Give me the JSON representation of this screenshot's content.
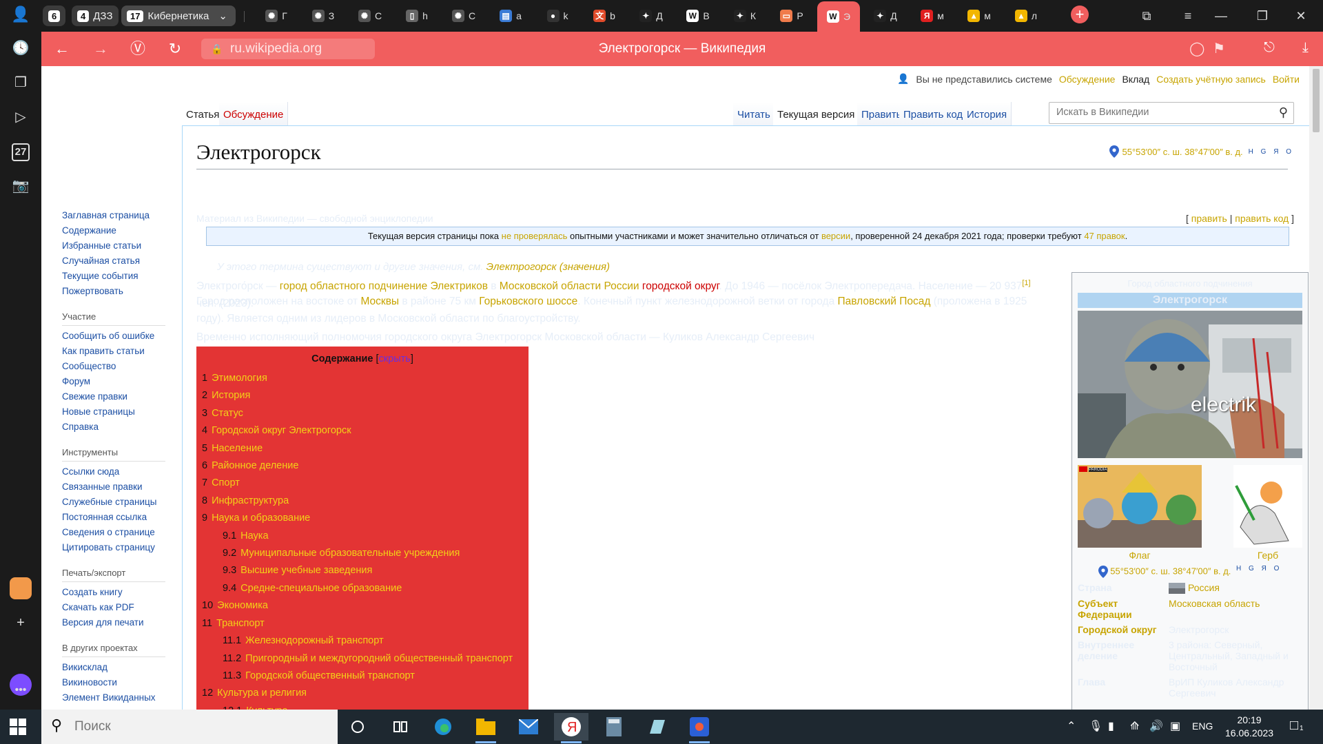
{
  "tabstrip": {
    "groups": [
      {
        "count": "6",
        "label": ""
      },
      {
        "count": "4",
        "label": "ДЗЗ"
      },
      {
        "count": "17",
        "label": "Кибернетика"
      }
    ],
    "mini_tabs": [
      {
        "letter": "Г",
        "icon": "chatgpt-icon"
      },
      {
        "letter": "З",
        "icon": "chatgpt-icon"
      },
      {
        "letter": "С",
        "icon": "chatgpt-icon"
      },
      {
        "letter": "h",
        "icon": "document-icon"
      },
      {
        "letter": "С",
        "icon": "chatgpt-icon"
      },
      {
        "letter": "a",
        "icon": "google-doc-icon"
      },
      {
        "letter": "k",
        "icon": "github-icon"
      },
      {
        "letter": "b",
        "icon": "translate-icon"
      },
      {
        "letter": "Д",
        "icon": "sparkle-icon"
      },
      {
        "letter": "В",
        "icon": "wikipedia-icon"
      },
      {
        "letter": "К",
        "icon": "sparkle-icon"
      },
      {
        "letter": "Р",
        "icon": "slides-icon"
      },
      {
        "letter": "Э",
        "icon": "wikipedia-icon"
      },
      {
        "letter": "Д",
        "icon": "sparkle-icon"
      },
      {
        "letter": "м",
        "icon": "yandex-icon"
      },
      {
        "letter": "м",
        "icon": "yandex-maps-icon"
      },
      {
        "letter": "л",
        "icon": "yandex-maps-icon"
      }
    ]
  },
  "sidepanel": {
    "calendar_day": "27"
  },
  "addressbar": {
    "url": "ru.wikipedia.org",
    "title": "Электрогорск — Википедия"
  },
  "personal": {
    "anon": "Вы не представились системе",
    "talk": "Обсуждение",
    "contrib": "Вклад",
    "create": "Создать учётную запись",
    "login": "Войти"
  },
  "nav": {
    "main": [
      "Заглавная страница",
      "Содержание",
      "Избранные статьи",
      "Случайная статья",
      "Текущие события",
      "Пожертвовать"
    ],
    "participation_title": "Участие",
    "participation": [
      "Сообщить об ошибке",
      "Как править статьи",
      "Сообщество",
      "Форум",
      "Свежие правки",
      "Новые страницы",
      "Справка"
    ],
    "tools_title": "Инструменты",
    "tools": [
      "Ссылки сюда",
      "Связанные правки",
      "Служебные страницы",
      "Постоянная ссылка",
      "Сведения о странице",
      "Цитировать страницу"
    ],
    "print_title": "Печать/экспорт",
    "print": [
      "Создать книгу",
      "Скачать как PDF",
      "Версия для печати"
    ],
    "projects_title": "В других проектах",
    "projects": [
      "Викисклад",
      "Викиновости",
      "Элемент Викиданных"
    ]
  },
  "tabs": {
    "article": "Статья",
    "talk": "Обсуждение",
    "read": "Читать",
    "current": "Текущая версия",
    "edit": "Править",
    "edit_code": "Править код",
    "history": "История"
  },
  "search": {
    "placeholder": "Искать в Википедии"
  },
  "article": {
    "title": "Электрогорск",
    "coords": "55°53′00″ с. ш. 38°47′00″ в. д.",
    "coord_letters": "H G Я O",
    "site_sub": "Материал из Википедии — свободной энциклопедии",
    "edit": "править",
    "edit_code": "править код",
    "flag": {
      "t1": "Текущая версия страницы пока ",
      "l1": "не проверялась",
      "t2": " опытными участниками и может значительно отличаться от ",
      "l2": "версии",
      "t3": ", проверенной 24 декабря 2021 года; проверки требуют ",
      "l3": "47 правок",
      "t4": "."
    },
    "hatnote": {
      "text": "У этого термина существуют и другие значения, см. ",
      "link": "Электрогорск (значения)"
    },
    "p1": {
      "a": "Электрого́рск — ",
      "l1": "город областного подчинение Электриков",
      "b": " в ",
      "l2": "Московской области России",
      "c": " ",
      "l3": "городской округ",
      "d": ". До 1946 — посёлок Электропередача. Население — 20 937",
      "ref": "[1]",
      "e": " чел. (2023)."
    },
    "p2": {
      "a": "Город расположен на востоке от ",
      "l1": "Москвы",
      "b": " в районе 75 км ",
      "l2": "Горьковского шоссе",
      "c": ". Конечный пункт железнодорожной ветки от города ",
      "l3": "Павловский Посад",
      "d": " (проложена в 1925 году). Является одним из лидеров в Московской области по благоустройству."
    },
    "p3": "Временно исполняющий полномочия городского округа Электрогорск Московской области — Куликов Александр Сергеевич"
  },
  "toc": {
    "title": "Содержание",
    "hide": "скрыть",
    "items": [
      {
        "n": "1",
        "t": "Этимология",
        "lvl": 1
      },
      {
        "n": "2",
        "t": "История",
        "lvl": 1
      },
      {
        "n": "3",
        "t": "Статус",
        "lvl": 1
      },
      {
        "n": "4",
        "t": "Городской округ Электрогорск",
        "lvl": 1
      },
      {
        "n": "5",
        "t": "Население",
        "lvl": 1
      },
      {
        "n": "6",
        "t": "Районное деление",
        "lvl": 1
      },
      {
        "n": "7",
        "t": "Спорт",
        "lvl": 1
      },
      {
        "n": "8",
        "t": "Инфраструктура",
        "lvl": 1
      },
      {
        "n": "9",
        "t": "Наука и образование",
        "lvl": 1
      },
      {
        "n": "9.1",
        "t": "Наука",
        "lvl": 2
      },
      {
        "n": "9.2",
        "t": "Муниципальные образовательные учреждения",
        "lvl": 2
      },
      {
        "n": "9.3",
        "t": "Высшие учебные заведения",
        "lvl": 2
      },
      {
        "n": "9.4",
        "t": "Средне-специальное образование",
        "lvl": 2
      },
      {
        "n": "10",
        "t": "Экономика",
        "lvl": 1
      },
      {
        "n": "11",
        "t": "Транспорт",
        "lvl": 1
      },
      {
        "n": "11.1",
        "t": "Железнодорожный транспорт",
        "lvl": 2
      },
      {
        "n": "11.2",
        "t": "Пригородный и междугородний общественный транспорт",
        "lvl": 2
      },
      {
        "n": "11.3",
        "t": "Городской общественный транспорт",
        "lvl": 2
      },
      {
        "n": "12",
        "t": "Культура и религия",
        "lvl": 1
      },
      {
        "n": "12.1",
        "t": "Культура",
        "lvl": 2
      }
    ]
  },
  "infobox": {
    "above": "Город областного подчинения",
    "title": "Электрогорск",
    "image_caption_overlay": "electrik",
    "flag_label": "Флаг",
    "flag_badge": "PARODIA",
    "coat_label": "Герб",
    "coords": "55°53′00″ с. ш. 38°47′00″ в. д.",
    "coord_letters": "H G Я O",
    "rows": [
      {
        "k": "Страна",
        "v": "Россия",
        "pale_k": true,
        "pale_v": false
      },
      {
        "k": "Субъект Федерации",
        "v": "Московская область",
        "pale_k": false,
        "pale_v": false
      },
      {
        "k": "Городской округ",
        "v": "Электрогорск",
        "pale_k": false,
        "pale_v": true
      },
      {
        "k": "Внутреннее деление",
        "v": "3 района: Северный, Центральный, Западный и Восточный",
        "pale_k": true,
        "pale_v": true
      },
      {
        "k": "Глава",
        "v": "ВрИП Куликов Александр Сергеевич",
        "pale_k": true,
        "pale_v": true
      }
    ]
  },
  "taskbar": {
    "search_placeholder": "Поиск",
    "lang": "ENG",
    "time": "20:19",
    "date": "16.06.2023",
    "notifications": "1"
  },
  "colors": {
    "accent": "#f15e5e",
    "link_yellow": "#c7a400",
    "toc_bg": "#e33434",
    "toc_text": "#f3d018"
  }
}
